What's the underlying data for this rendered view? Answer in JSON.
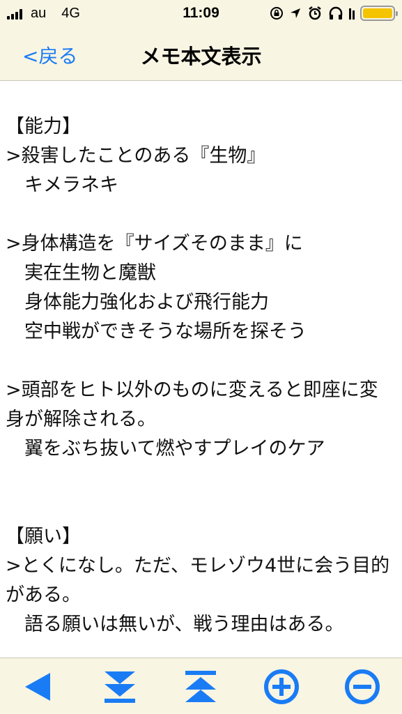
{
  "status_bar": {
    "carrier": "au",
    "network": "4G",
    "time": "11:09",
    "battery_color": "#f5c400"
  },
  "nav": {
    "back_label": "<戻る",
    "title": "メモ本文表示",
    "accent_color": "#1a7cf4"
  },
  "memo": {
    "text": "【能力】\n>殺害したことのある『生物』\n　キメラネキ\n\n>身体構造を『サイズそのまま』に\n　実在生物と魔獣\n　身体能力強化および飛行能力\n　空中戦ができそうな場所を探そう\n\n>頭部をヒト以外のものに変えると即座に変身が解除される。\n　翼をぶち抜いて燃やすプレイのケア\n\n\n【願い】\n>とくになし。ただ、モレゾウ4世に会う目的がある。\n　語る願いは無いが、戦う理由はある。"
  },
  "toolbar": {
    "icons": [
      "back-triangle-icon",
      "scroll-to-bottom-icon",
      "scroll-to-top-icon",
      "plus-circle-icon",
      "minus-circle-icon"
    ],
    "icon_color": "#1a7cf4"
  }
}
